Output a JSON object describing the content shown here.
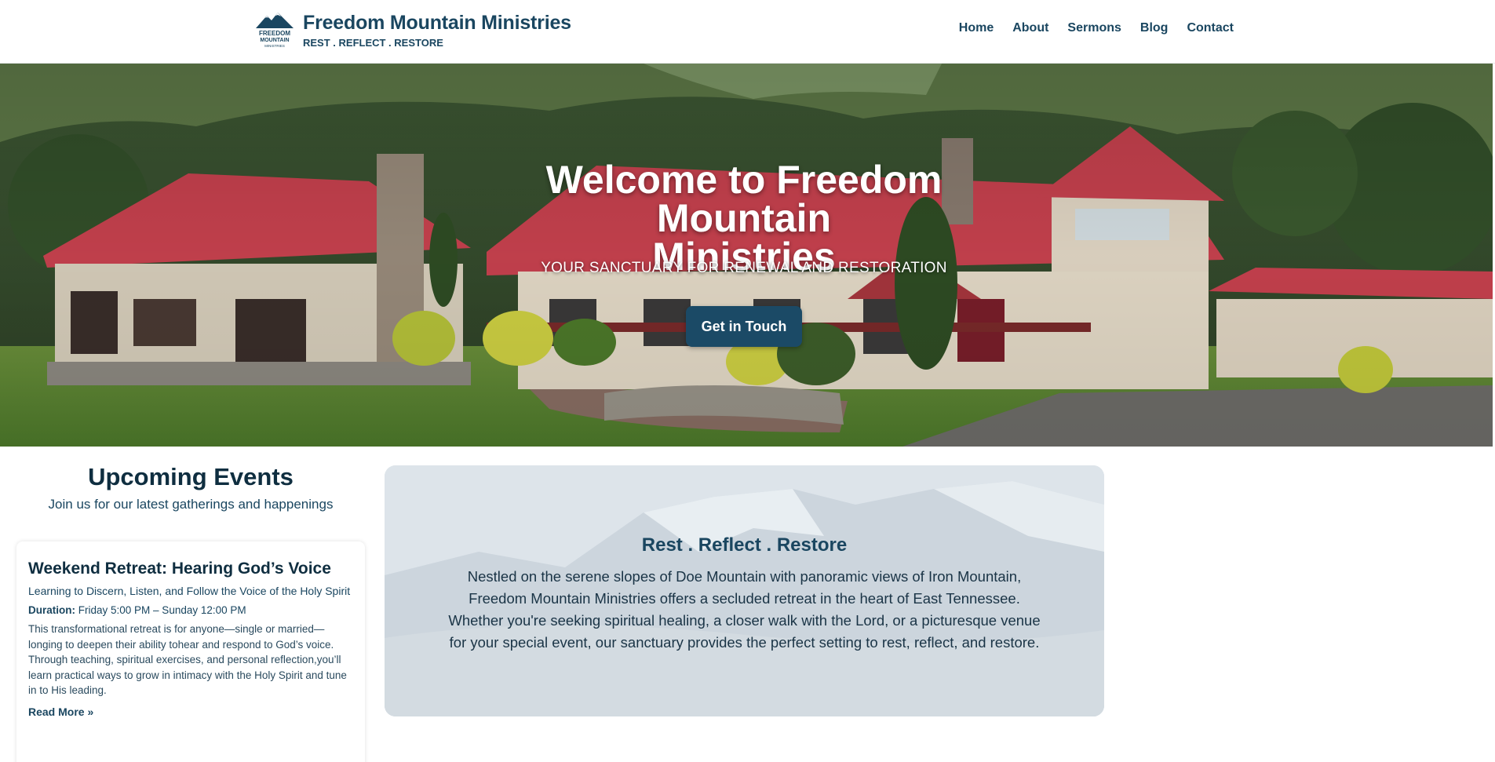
{
  "site": {
    "title": "Freedom Mountain Ministries",
    "tagline": "REST . REFLECT . RESTORE",
    "logo_text": [
      "FREEDOM",
      "MOUNTAIN",
      "MINISTRIES"
    ]
  },
  "nav": {
    "items": [
      {
        "label": "Home"
      },
      {
        "label": "About"
      },
      {
        "label": "Sermons"
      },
      {
        "label": "Blog"
      },
      {
        "label": "Contact"
      }
    ]
  },
  "hero": {
    "title_line1": "Welcome to Freedom Mountain",
    "title_line2": "Ministries",
    "subtitle": "YOUR SANCTUARY FOR RENEWAL AND RESTORATION",
    "button_label": "Get in Touch"
  },
  "events": {
    "title": "Upcoming Events",
    "subtitle": "Join us for our latest gatherings and happenings",
    "items": [
      {
        "title": "Weekend Retreat: Hearing God’s Voice",
        "subtitle": "Learning to Discern, Listen, and Follow the Voice of the Holy Spirit",
        "duration_label": "Duration:",
        "duration_value": "Friday 5:00 PM – Sunday 12:00 PM",
        "description": "This transformational retreat is for anyone—single or married—longing to deepen their ability tohear and respond to God’s voice. Through teaching, spiritual exercises, and personal reflection,you’ll learn practical ways to grow in intimacy with the Holy Spirit and tune in to His leading.",
        "link_label": "Read More »"
      }
    ]
  },
  "about": {
    "title": "Rest . Reflect . Restore",
    "text": "Nestled on the serene slopes of Doe Mountain with panoramic views of Iron Mountain, Freedom Mountain Ministries offers a secluded retreat in the heart of East Tennessee. Whether you're seeking spiritual healing, a closer walk with the Lord, or a picturesque venue for your special event, our sanctuary provides the perfect setting to rest, reflect, and restore."
  },
  "colors": {
    "brand_navy": "#1a4660",
    "button_bg": "#1b4a66",
    "roof_red": "#c9424f",
    "about_panel": "#dde4ea"
  }
}
